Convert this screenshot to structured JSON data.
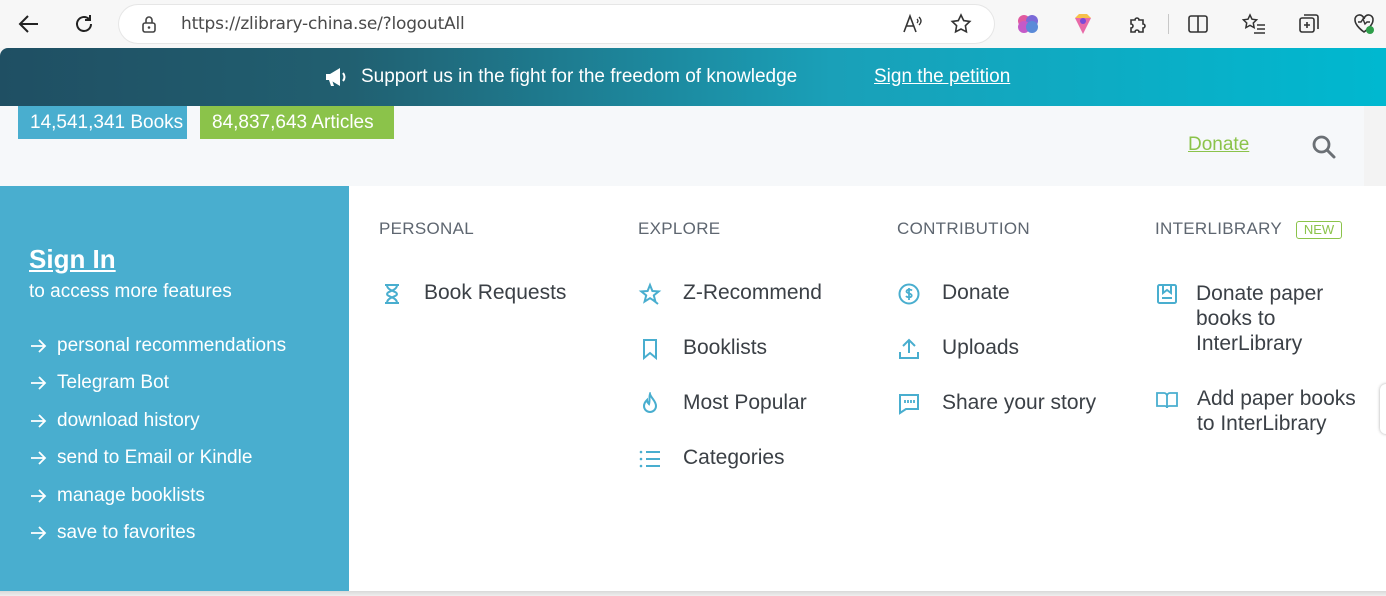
{
  "browser": {
    "url": "https://zlibrary-china.se/?logoutAll",
    "read_aloud": "A̅"
  },
  "banner": {
    "message": "Support us in the fight for the freedom of knowledge",
    "petition": "Sign the petition"
  },
  "header": {
    "books_badge": "14,541,341 Books",
    "articles_badge": "84,837,643 Articles",
    "donate": "Donate"
  },
  "signin": {
    "title": "Sign In",
    "subtitle": "to access more features",
    "features": [
      "personal recommendations",
      "Telegram Bot",
      "download history",
      "send to Email or Kindle",
      "manage booklists",
      "save to favorites"
    ]
  },
  "columns": {
    "personal": {
      "heading": "PERSONAL",
      "items": [
        "Book Requests"
      ]
    },
    "explore": {
      "heading": "EXPLORE",
      "items": [
        "Z-Recommend",
        "Booklists",
        "Most Popular",
        "Categories"
      ]
    },
    "contribution": {
      "heading": "CONTRIBUTION",
      "items": [
        "Donate",
        "Uploads",
        "Share your story"
      ]
    },
    "interlibrary": {
      "heading": "INTERLIBRARY",
      "badge": "NEW",
      "items": [
        {
          "line1": "Donate paper",
          "line2": "books to",
          "line3": "InterLibrary"
        },
        {
          "line1": "Add paper books",
          "line2": "to InterLibrary"
        }
      ]
    }
  },
  "colors": {
    "accent_blue": "#49aecf",
    "accent_green": "#8bc34a",
    "text_dark": "#3b4046"
  }
}
